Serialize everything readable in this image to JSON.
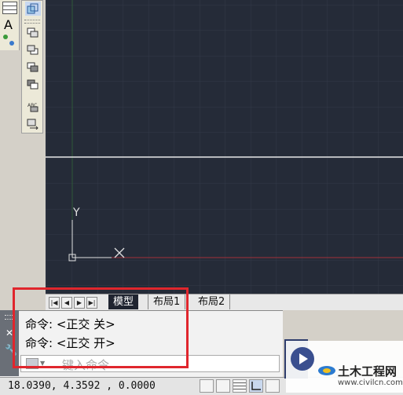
{
  "layout_tabs": {
    "model": "模型",
    "layout1": "布局1",
    "layout2": "布局2"
  },
  "command_history": [
    "命令:  <正交 关>",
    "命令:  <正交 开>"
  ],
  "command_input": {
    "placeholder": "键入命令"
  },
  "status_bar": {
    "coordinates": "18.0390, 4.3592 , 0.0000"
  },
  "ucs": {
    "y_label": "Y"
  },
  "toolbar": {
    "text_tool": "A"
  },
  "watermark": {
    "title": "土木工程网",
    "url": "www.civilcn.com"
  },
  "colors": {
    "canvas": "#252b38",
    "grid": "#323948",
    "highlight_box": "#e0262d",
    "x_axis": "#a2323a",
    "y_axis": "#2e5a37"
  }
}
